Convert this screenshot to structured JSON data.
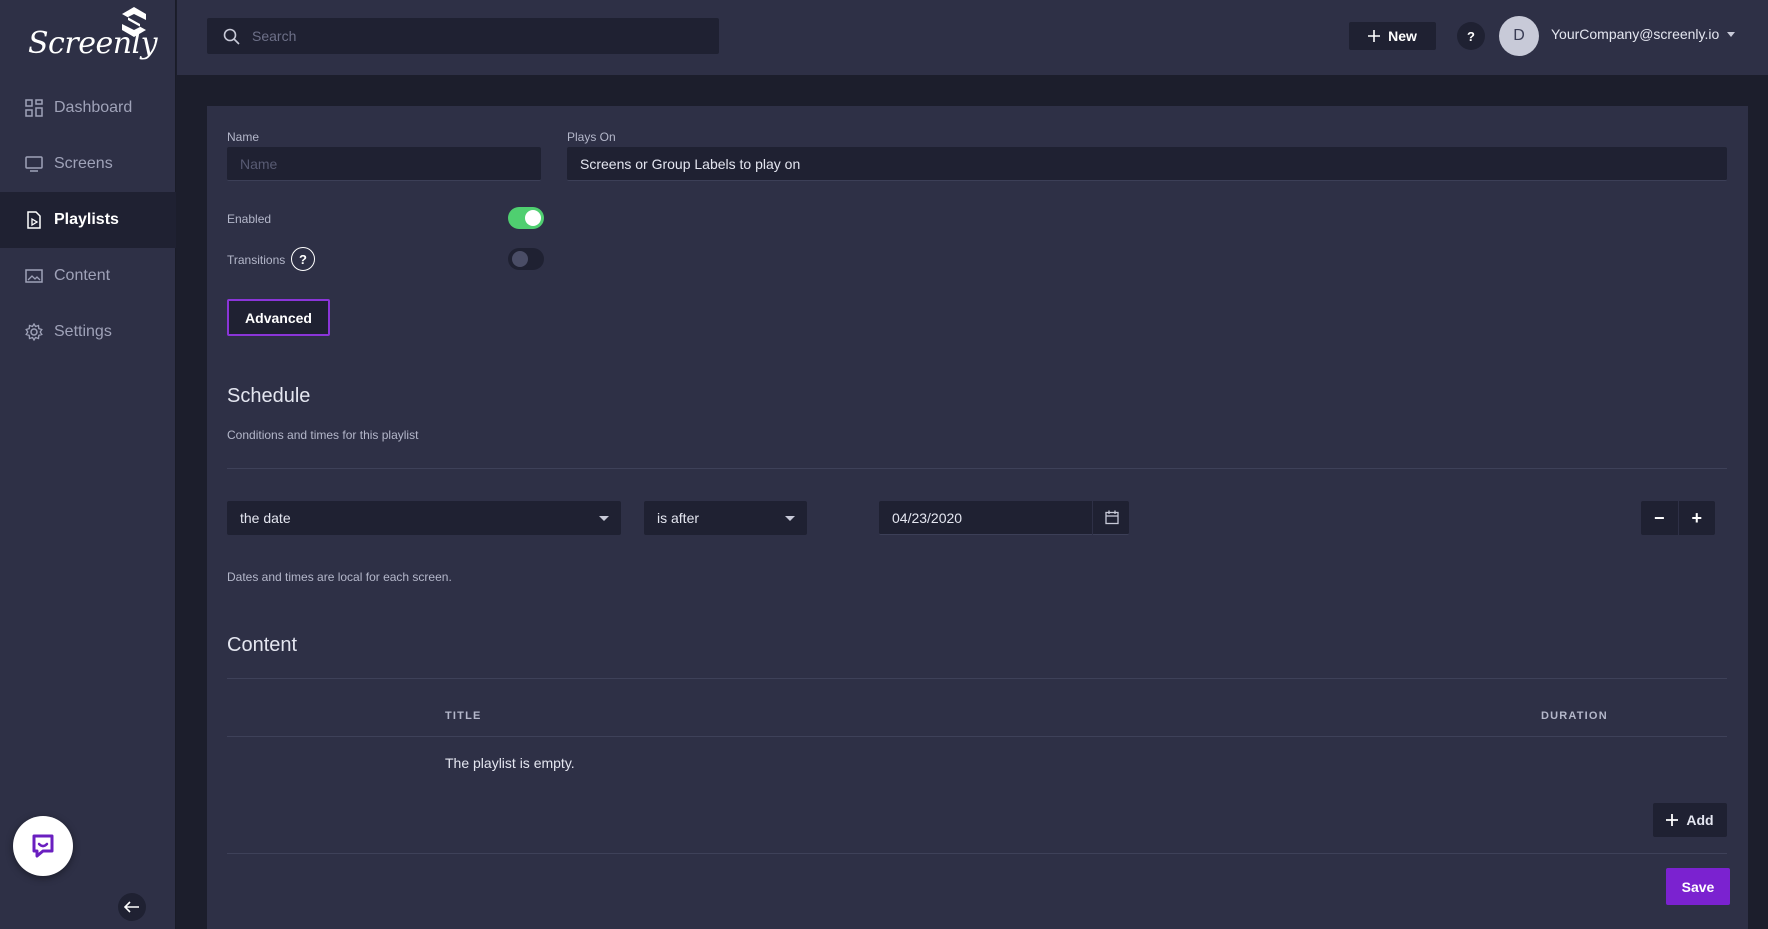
{
  "app": {
    "logo_text": "Screenly",
    "brand_color": "#7b22d0",
    "accent_toggle_on": "#4fcf70"
  },
  "sidebar": {
    "items": [
      {
        "label": "Dashboard",
        "icon": "dashboard-icon",
        "active": false
      },
      {
        "label": "Screens",
        "icon": "screen-icon",
        "active": false
      },
      {
        "label": "Playlists",
        "icon": "playlist-icon",
        "active": true
      },
      {
        "label": "Content",
        "icon": "image-icon",
        "active": false
      },
      {
        "label": "Settings",
        "icon": "gear-icon",
        "active": false
      }
    ]
  },
  "topbar": {
    "search_placeholder": "Search",
    "new_label": "New",
    "help_label": "?",
    "avatar_initial": "D",
    "account_email": "YourCompany@screenly.io"
  },
  "form": {
    "name_label": "Name",
    "name_placeholder": "Name",
    "plays_on_label": "Plays On",
    "plays_on_value": "Screens or Group Labels to play on",
    "enabled_label": "Enabled",
    "enabled": true,
    "transitions_label": "Transitions",
    "transitions": false,
    "transitions_help": "?",
    "advanced_label": "Advanced"
  },
  "schedule": {
    "title": "Schedule",
    "subtitle": "Conditions and times for this playlist",
    "condition_field": "the date",
    "operator": "is after",
    "date_value": "04/23/2020",
    "minus_label": "−",
    "plus_label": "+",
    "note": "Dates and times are local for each screen."
  },
  "content": {
    "title": "Content",
    "columns": [
      "TITLE",
      "DURATION"
    ],
    "empty_text": "The playlist is empty.",
    "add_label": "Add",
    "save_label": "Save"
  }
}
